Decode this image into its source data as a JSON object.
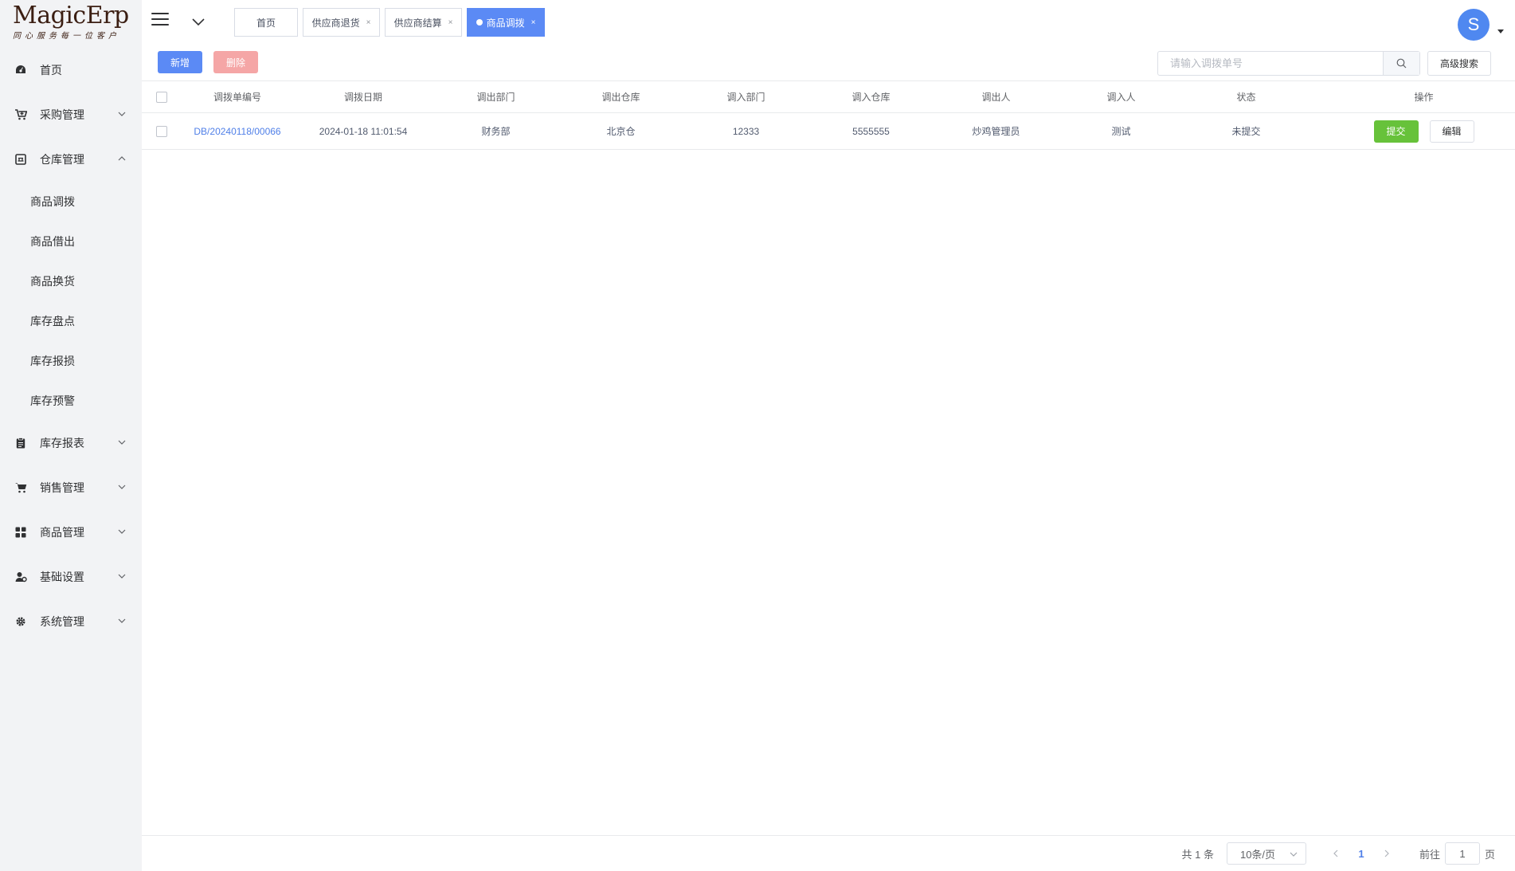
{
  "logo": {
    "title": "MagicErp",
    "tagline": "同心服务每一位客户"
  },
  "sidebar": {
    "items": [
      {
        "label": "首页",
        "icon": "dashboard-icon"
      },
      {
        "label": "采购管理",
        "icon": "cart-plus-icon",
        "expandable": true
      },
      {
        "label": "仓库管理",
        "icon": "warehouse-icon",
        "expanded": true,
        "children": [
          "商品调拨",
          "商品借出",
          "商品换货",
          "库存盘点",
          "库存报损",
          "库存预警"
        ]
      },
      {
        "label": "库存报表",
        "icon": "clipboard-icon",
        "expandable": true
      },
      {
        "label": "销售管理",
        "icon": "cart-icon",
        "expandable": true
      },
      {
        "label": "商品管理",
        "icon": "grid-icon",
        "expandable": true
      },
      {
        "label": "基础设置",
        "icon": "user-gear-icon",
        "expandable": true
      },
      {
        "label": "系统管理",
        "icon": "gear-icon",
        "expandable": true
      }
    ]
  },
  "header": {
    "tabs": [
      {
        "label": "首页",
        "closable": false,
        "active": false
      },
      {
        "label": "供应商退货",
        "closable": true,
        "active": false
      },
      {
        "label": "供应商结算",
        "closable": true,
        "active": false
      },
      {
        "label": "商品调拨",
        "closable": true,
        "active": true
      }
    ],
    "close_glyph": "×",
    "avatar_letter": "S"
  },
  "toolbar": {
    "add_label": "新增",
    "delete_label": "删除",
    "search_placeholder": "请输入调拨单号",
    "advanced_search_label": "高级搜索"
  },
  "table": {
    "columns": [
      "调拨单编号",
      "调拨日期",
      "调出部门",
      "调出仓库",
      "调入部门",
      "调入仓库",
      "调出人",
      "调入人",
      "状态",
      "操作"
    ],
    "rows": [
      {
        "code": "DB/20240118/00066",
        "date": "2024-01-18 11:01:54",
        "out_dept": "财务部",
        "out_warehouse": "北京仓",
        "in_dept": "12333",
        "in_warehouse": "5555555",
        "out_person": "炒鸡管理员",
        "in_person": "测试",
        "status": "未提交",
        "submit_label": "提交",
        "edit_label": "编辑"
      }
    ]
  },
  "pagination": {
    "total_text": "共 1 条",
    "page_size": "10条/页",
    "current_page": "1",
    "goto_label": "前往",
    "jump_value": "1",
    "page_unit": "页"
  },
  "colors": {
    "primary": "#5b8af5",
    "danger_disabled": "#f5a6a6",
    "success": "#67c23a",
    "sidebar_bg": "#f2f3f5"
  }
}
